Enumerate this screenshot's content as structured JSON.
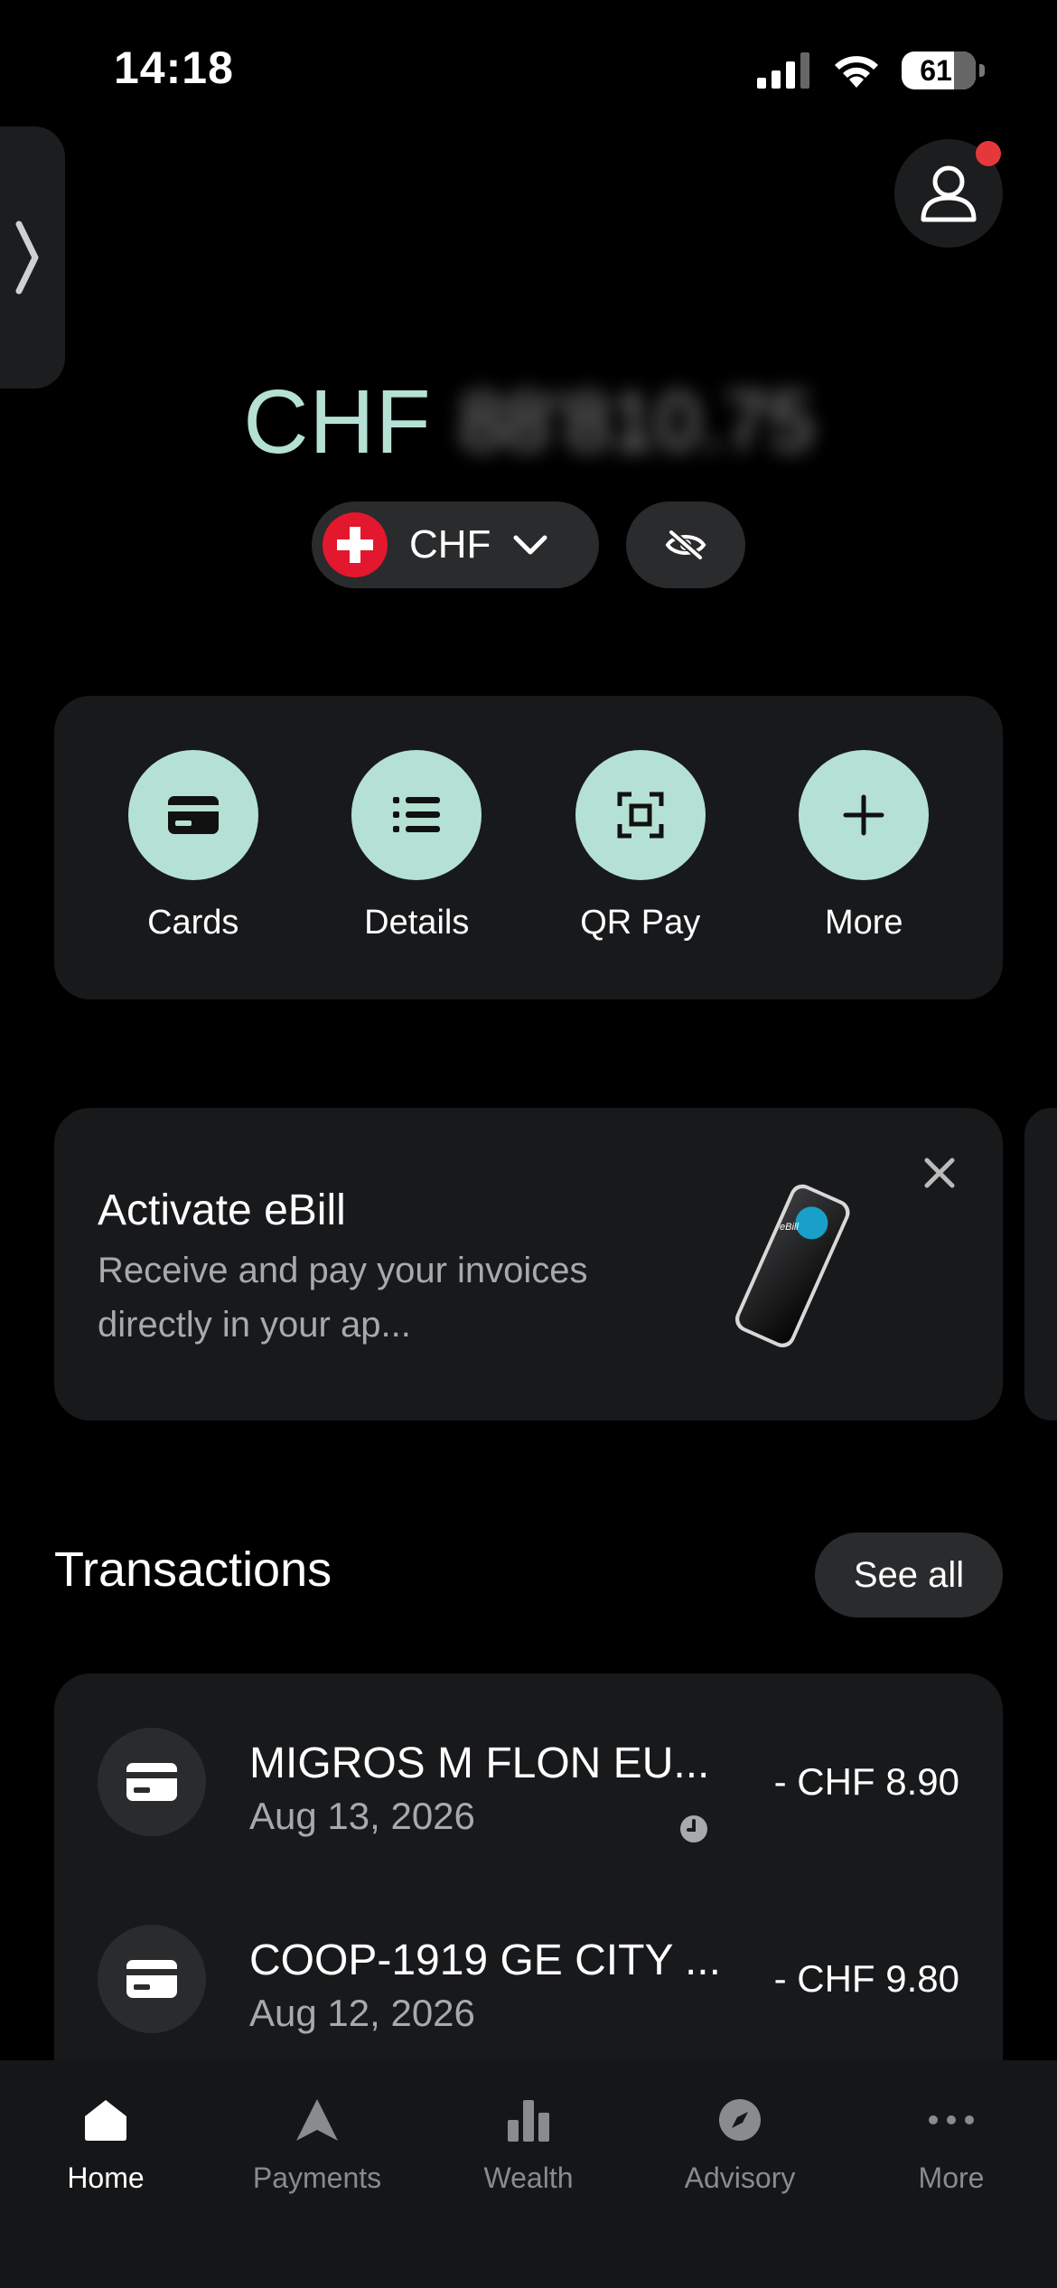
{
  "status_bar": {
    "time": "14:18",
    "battery": "61"
  },
  "balance": {
    "currency": "CHF",
    "amount": "88'810.75"
  },
  "currency_selector": {
    "label": "CHF"
  },
  "quick_actions": [
    {
      "label": "Cards",
      "icon": "card-icon"
    },
    {
      "label": "Details",
      "icon": "list-icon"
    },
    {
      "label": "QR Pay",
      "icon": "qr-scan-icon"
    },
    {
      "label": "More",
      "icon": "plus-icon"
    }
  ],
  "promo": {
    "title": "Activate eBill",
    "text": "Receive and pay your invoices directly in your ap...",
    "badge": "eBill"
  },
  "transactions": {
    "heading": "Transactions",
    "see_all": "See all",
    "items": [
      {
        "name": "MIGROS M FLON EU...",
        "date": "Aug 13, 2026",
        "amount": "- CHF 8.90",
        "pending": true
      },
      {
        "name": "COOP-1919 GE CITY ...",
        "date": "Aug 12, 2026",
        "amount": "- CHF 9.80",
        "pending": false
      }
    ]
  },
  "bottom_nav": [
    {
      "label": "Home",
      "icon": "home-icon",
      "active": true
    },
    {
      "label": "Payments",
      "icon": "payments-icon",
      "active": false
    },
    {
      "label": "Wealth",
      "icon": "bar-chart-icon",
      "active": false
    },
    {
      "label": "Advisory",
      "icon": "compass-icon",
      "active": false
    },
    {
      "label": "More",
      "icon": "more-dots-icon",
      "active": false
    }
  ],
  "colors": {
    "accent": "#b4e1d4",
    "card": "#18191b",
    "pill": "#2a2b2d",
    "notification": "#e5383b"
  }
}
